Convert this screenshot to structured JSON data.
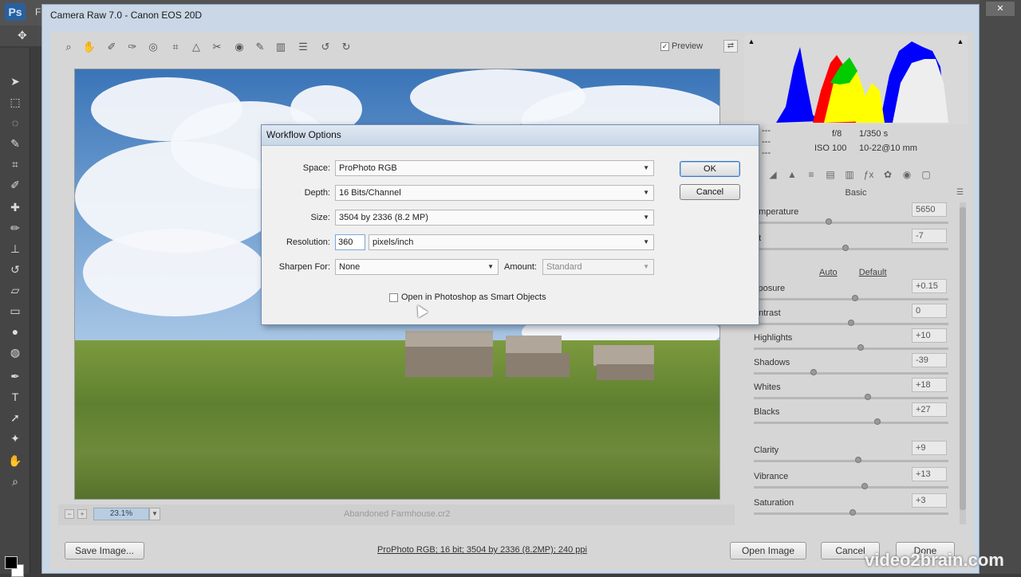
{
  "photoshop": {
    "logo": "Ps",
    "menu_first": "F"
  },
  "acr": {
    "title": "Camera Raw 7.0  -  Canon EOS 20D",
    "preview_label": "Preview",
    "zoom_level": "23.1%",
    "filename": "Abandoned Farmhouse.cr2",
    "workflow_link": "ProPhoto RGB; 16 bit; 3504 by 2336 (8.2MP); 240 ppi",
    "buttons": {
      "save_image": "Save Image...",
      "open_image": "Open Image",
      "cancel": "Cancel",
      "done": "Done"
    }
  },
  "camera_info": {
    "r": "---",
    "g": "---",
    "b": "---",
    "aperture": "f/8",
    "shutter": "1/350 s",
    "iso": "ISO 100",
    "lens": "10-22@10 mm"
  },
  "panel": {
    "title": "Basic",
    "auto": "Auto",
    "default": "Default",
    "sliders": [
      {
        "label": "emperature",
        "value": "5650",
        "level": 0.38
      },
      {
        "label": "nt",
        "value": "-7",
        "level": 0.47
      },
      {
        "label": "xposure",
        "value": "+0.15",
        "level": 0.52
      },
      {
        "label": "ontrast",
        "value": "0",
        "level": 0.5
      },
      {
        "label": "Highlights",
        "value": "+10",
        "level": 0.55
      },
      {
        "label": "Shadows",
        "value": "-39",
        "level": 0.3
      },
      {
        "label": "Whites",
        "value": "+18",
        "level": 0.59
      },
      {
        "label": "Blacks",
        "value": "+27",
        "level": 0.64
      },
      {
        "label": "Clarity",
        "value": "+9",
        "level": 0.54
      },
      {
        "label": "Vibrance",
        "value": "+13",
        "level": 0.57
      },
      {
        "label": "Saturation",
        "value": "+3",
        "level": 0.51
      }
    ]
  },
  "dialog": {
    "title": "Workflow Options",
    "space_label": "Space:",
    "space_value": "ProPhoto RGB",
    "depth_label": "Depth:",
    "depth_value": "16 Bits/Channel",
    "size_label": "Size:",
    "size_value": "3504 by 2336  (8.2 MP)",
    "resolution_label": "Resolution:",
    "resolution_value": "360",
    "resolution_unit": "pixels/inch",
    "sharpen_label": "Sharpen For:",
    "sharpen_value": "None",
    "amount_label": "Amount:",
    "amount_value": "Standard",
    "smart_objects_label": "Open in Photoshop as Smart Objects",
    "ok": "OK",
    "cancel": "Cancel"
  },
  "watermark": "video2brain.com"
}
